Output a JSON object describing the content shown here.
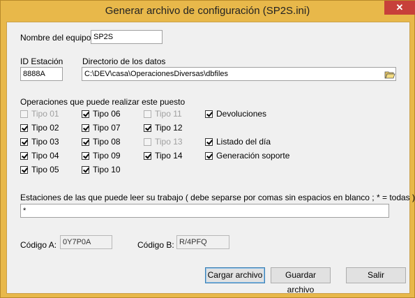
{
  "window": {
    "title": "Generar archivo de configuración (SP2S.ini)",
    "close_glyph": "✕"
  },
  "equipo": {
    "label": "Nombre del equipo:",
    "value": "SP2S"
  },
  "estacion": {
    "label": "ID Estación",
    "value": "8888A"
  },
  "directorio": {
    "label": "Directorio de los datos",
    "value": "C:\\DEV\\casa\\OperacionesDiversas\\dbfiles"
  },
  "operaciones": {
    "label": "Operaciones que puede realizar este puesto",
    "items": [
      {
        "label": "Tipo 01",
        "checked": false,
        "enabled": false
      },
      {
        "label": "Tipo 02",
        "checked": true,
        "enabled": true
      },
      {
        "label": "Tipo 03",
        "checked": true,
        "enabled": true
      },
      {
        "label": "Tipo 04",
        "checked": true,
        "enabled": true
      },
      {
        "label": "Tipo 05",
        "checked": true,
        "enabled": true
      },
      {
        "label": "Tipo 06",
        "checked": true,
        "enabled": true
      },
      {
        "label": "Tipo 07",
        "checked": true,
        "enabled": true
      },
      {
        "label": "Tipo 08",
        "checked": true,
        "enabled": true
      },
      {
        "label": "Tipo 09",
        "checked": true,
        "enabled": true
      },
      {
        "label": "Tipo 10",
        "checked": true,
        "enabled": true
      },
      {
        "label": "Tipo 11",
        "checked": false,
        "enabled": false
      },
      {
        "label": "Tipo 12",
        "checked": true,
        "enabled": true
      },
      {
        "label": "Tipo 13",
        "checked": false,
        "enabled": false
      },
      {
        "label": "Tipo 14",
        "checked": true,
        "enabled": true
      },
      {
        "label": "Devoluciones",
        "checked": true,
        "enabled": true
      },
      {
        "label": "Listado del día",
        "checked": true,
        "enabled": true
      },
      {
        "label": "Generación soporte",
        "checked": true,
        "enabled": true
      }
    ]
  },
  "estaciones": {
    "label": "Estaciones de las que puede leer su trabajo ( debe separse por comas sin espacios en blanco ; * = todas )",
    "value": "*"
  },
  "codigo_a": {
    "label": "Código A:",
    "value": "0Y7P0A"
  },
  "codigo_b": {
    "label": "Código B:",
    "value": "R/4PFQ"
  },
  "buttons": {
    "cargar": "Cargar archivo",
    "guardar": "Guardar archivo",
    "salir": "Salir"
  },
  "colors": {
    "titlebar": "#e8b84a",
    "close": "#c7403a",
    "dialog_bg": "#f0f0f0"
  },
  "icons": {
    "folder": "folder-open-icon"
  }
}
